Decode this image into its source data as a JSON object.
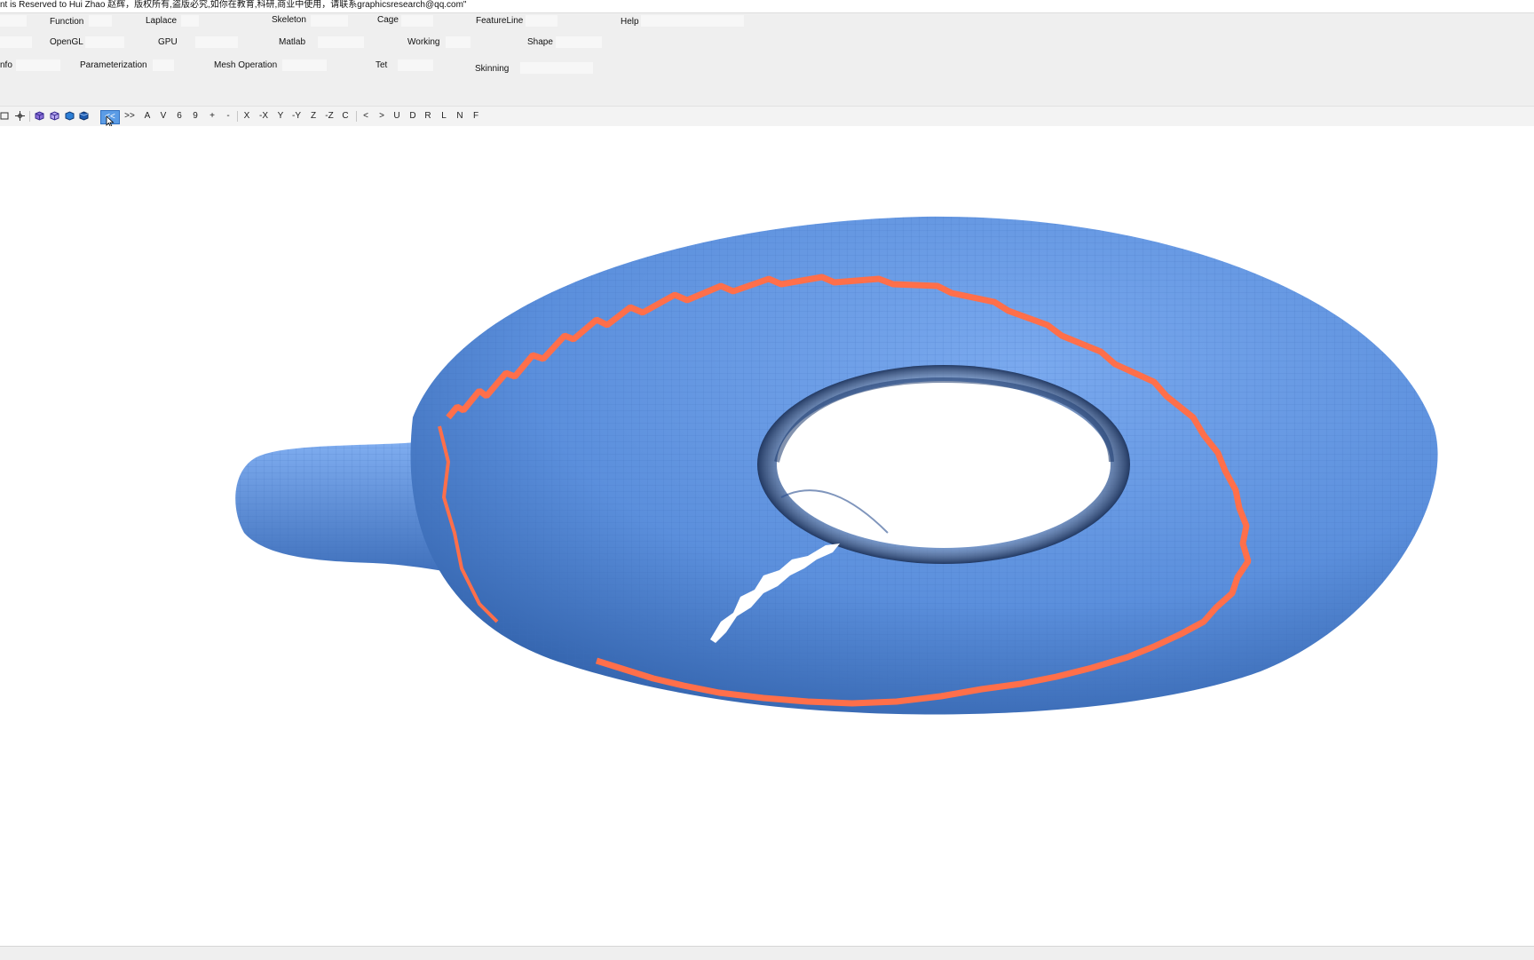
{
  "window": {
    "title": "nt is Reserved to Hui Zhao 赵辉，版权所有,盗版必究,如你在教育,科研,商业中使用，请联系graphicsresearch@qq.com\""
  },
  "menu": {
    "row1": [
      "Function",
      "Laplace",
      "Skeleton",
      "Cage",
      "FeatureLine",
      "Help"
    ],
    "row2": [
      "OpenGL",
      "GPU",
      "Matlab",
      "Working",
      "Shape"
    ],
    "row3": [
      "nfo",
      "Parameterization",
      "Mesh Operation",
      "Tet",
      "Skinning"
    ]
  },
  "toolbar": {
    "icons": [
      "select-rect-icon",
      "move-icon",
      "shaded-cube-icon",
      "wire-cube-icon",
      "solid-cube-icon",
      "flat-cube-icon"
    ],
    "prev_label": "<<",
    "next_label": ">>",
    "view_buttons": [
      "A",
      "V",
      "6",
      "9",
      "+",
      "-"
    ],
    "axis_buttons": [
      "X",
      "-X",
      "Y",
      "-Y",
      "Z",
      "-Z",
      "C"
    ],
    "nav_buttons": [
      "<",
      ">",
      "U",
      "D",
      "R",
      "L",
      "N",
      "F"
    ]
  },
  "viewport": {
    "model_name": "torus-with-handle-mesh",
    "colors": {
      "mesh_fill": "#5b8fdc",
      "mesh_dark": "#2f5fa8",
      "seam": "#ff6f4a",
      "grid": "#3d6bb8"
    }
  }
}
